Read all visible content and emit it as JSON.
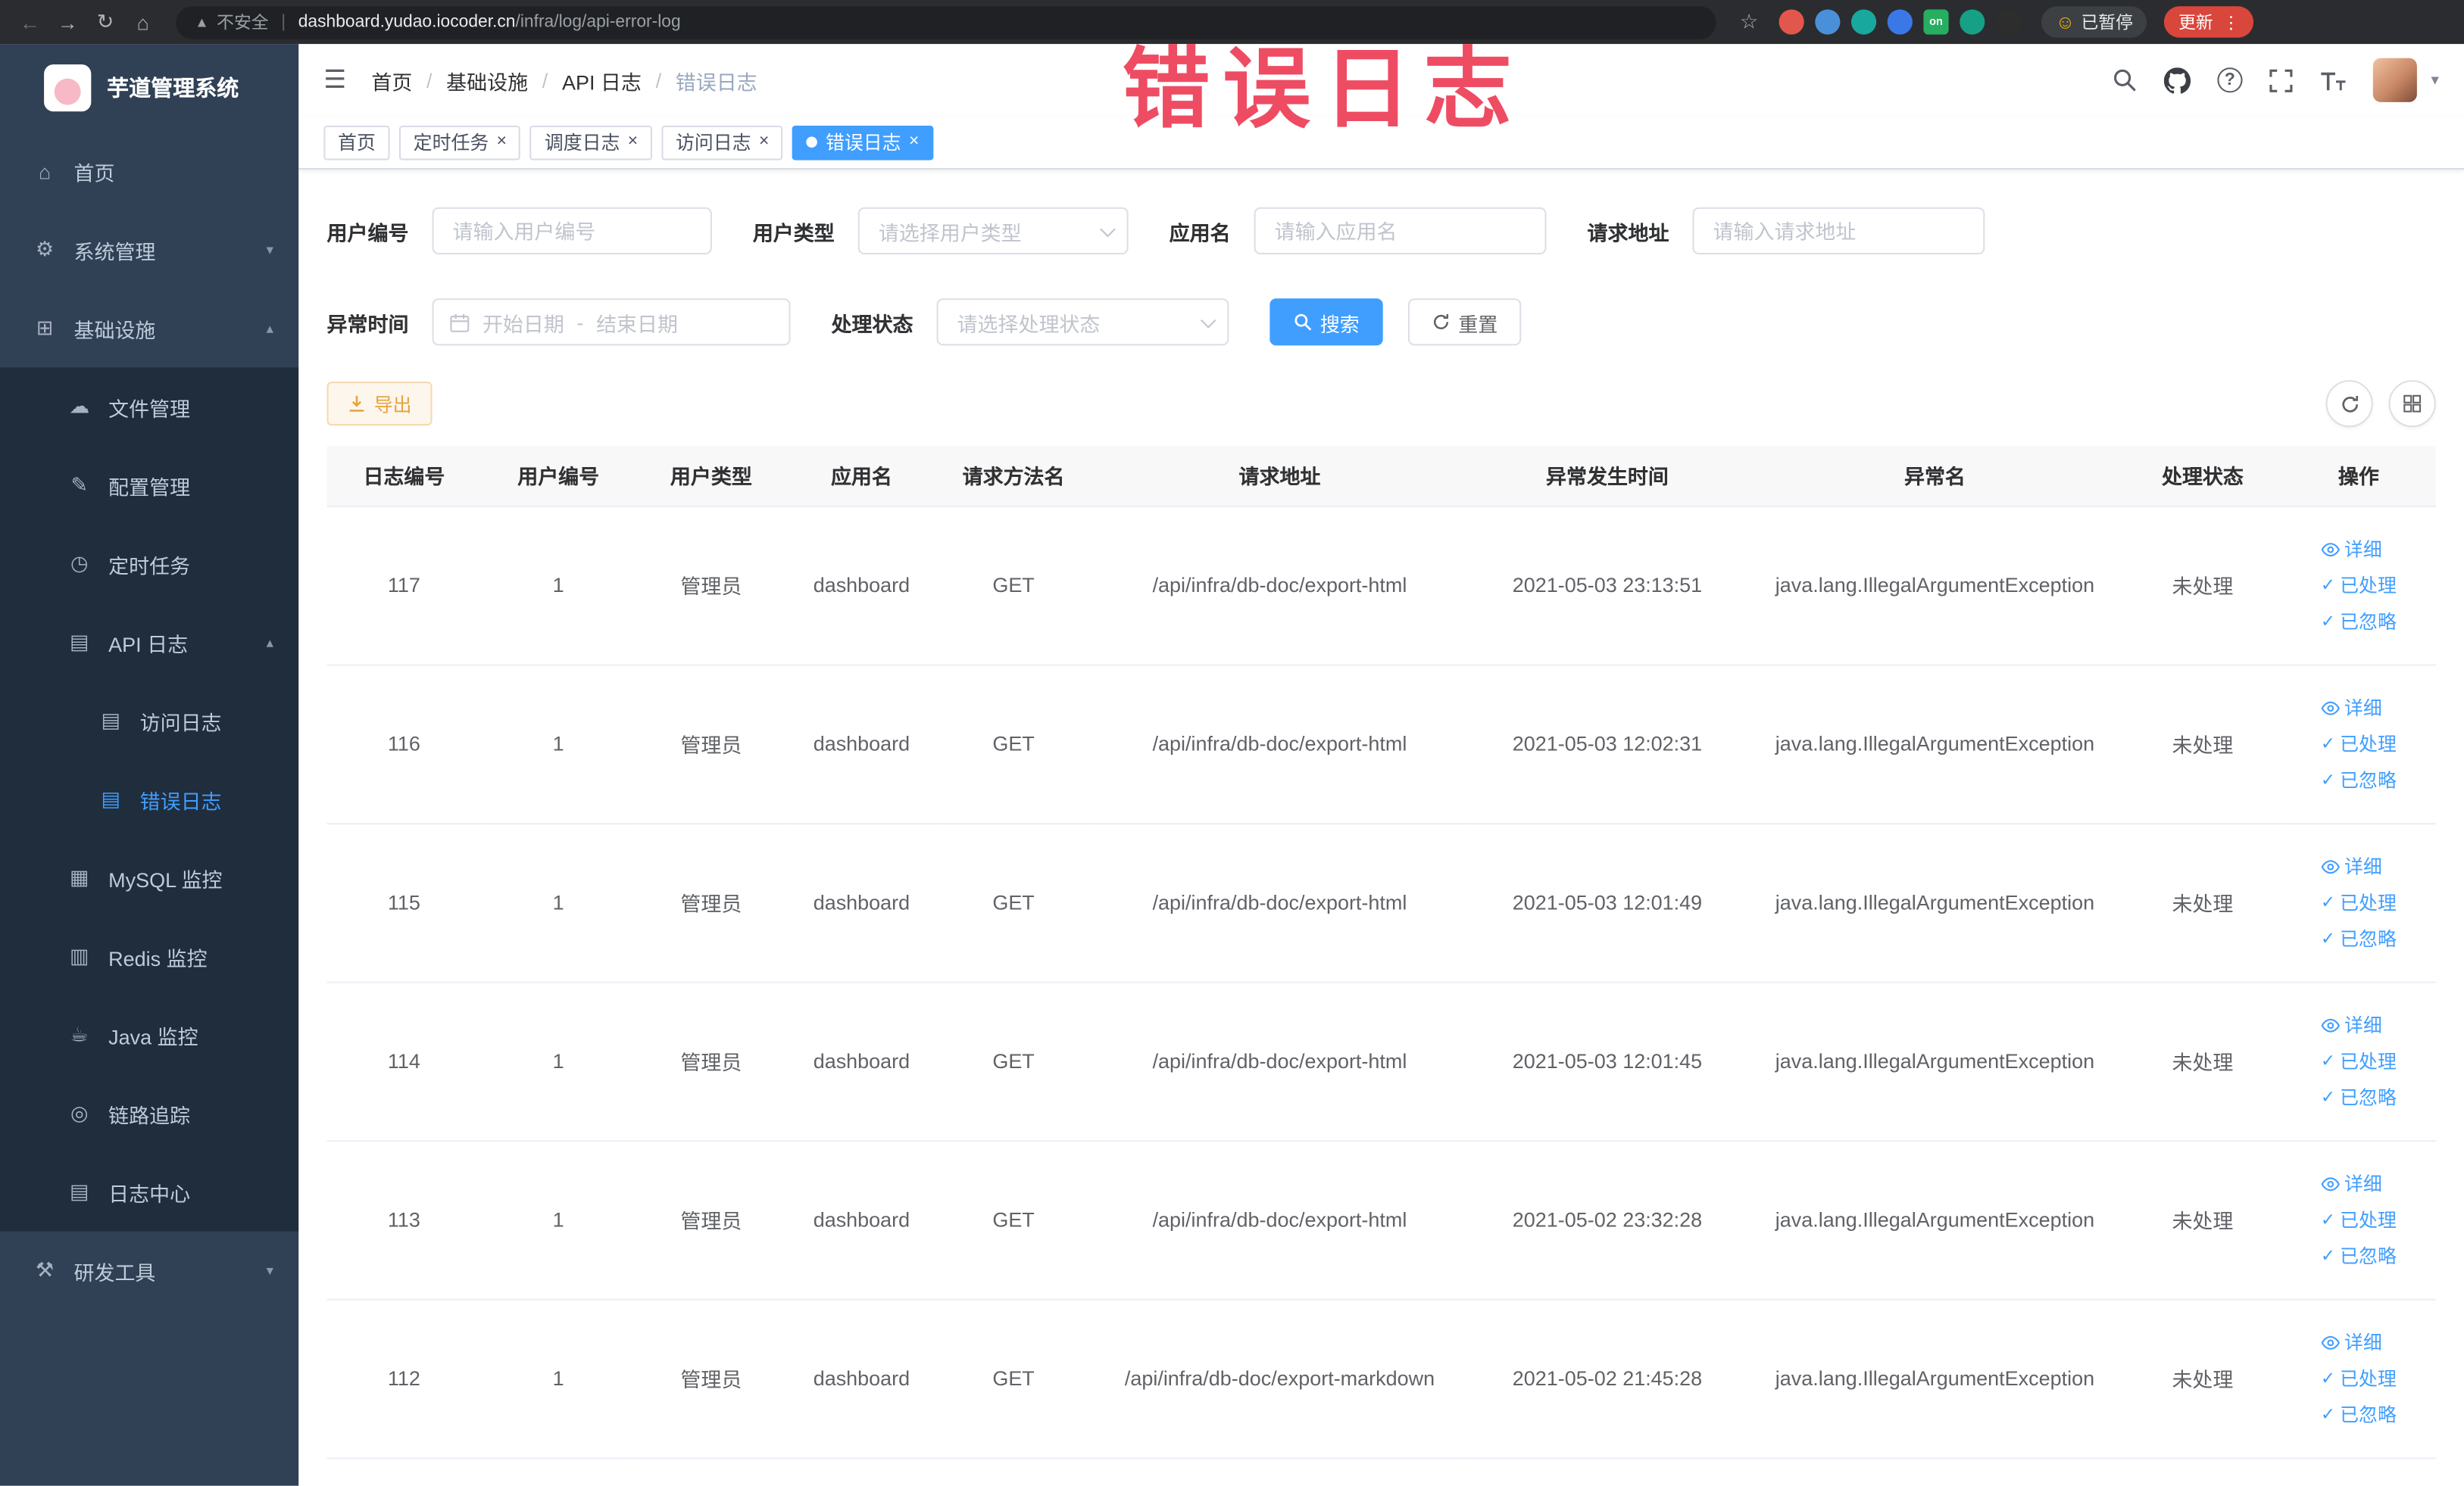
{
  "annotation": {
    "text": "错误日志"
  },
  "colors": {
    "primary": "#409eff",
    "sidebar_bg": "#304156",
    "submenu_bg": "#1f2d3d",
    "warning_text": "#e6a23c",
    "warning_bg": "#fdf6ec",
    "annotation": "#ee4c63"
  },
  "icons": {
    "back": "←",
    "forward": "→",
    "reload": "↻",
    "home": "⌂",
    "star": "☆",
    "menu": "⋮",
    "hamburger": "☰",
    "caret_down": "▾",
    "close": "×",
    "warning": "▲",
    "smiley": "☺",
    "separator": "|",
    "arrow_up": "▴",
    "arrow_down": "▾",
    "breadcrumb_separator": "/"
  },
  "browser": {
    "security_label": "不安全",
    "url_domain": "dashboard.yudao.iocoder.cn",
    "url_path": "/infra/log/api-error-log",
    "paused_label": "已暂停",
    "update_label": "更新",
    "ext_on_label": "on"
  },
  "sidebar": {
    "logo_title": "芋道管理系统",
    "items": [
      {
        "key": "home",
        "label": "首页",
        "level": 1,
        "icon": "home-icon",
        "glyph": "⌂"
      },
      {
        "key": "system-management",
        "label": "系统管理",
        "level": 1,
        "icon": "gear-icon",
        "glyph": "⚙",
        "arrow": "down"
      },
      {
        "key": "infrastructure",
        "label": "基础设施",
        "level": 1,
        "icon": "grid-icon",
        "glyph": "⊞",
        "arrow": "up"
      },
      {
        "key": "file-management",
        "label": "文件管理",
        "level": 2,
        "icon": "cloud-icon",
        "glyph": "☁"
      },
      {
        "key": "config-management",
        "label": "配置管理",
        "level": 2,
        "icon": "edit-icon",
        "glyph": "✎"
      },
      {
        "key": "scheduled-tasks",
        "label": "定时任务",
        "level": 2,
        "icon": "clock-icon",
        "glyph": "◷"
      },
      {
        "key": "api-log",
        "label": "API 日志",
        "level": 2,
        "icon": "document-icon",
        "glyph": "▤",
        "arrow": "up"
      },
      {
        "key": "access-log",
        "label": "访问日志",
        "level": 3,
        "icon": "document-icon",
        "glyph": "▤"
      },
      {
        "key": "error-log",
        "label": "错误日志",
        "level": 3,
        "icon": "document-icon",
        "glyph": "▤",
        "active": true
      },
      {
        "key": "mysql-monitor",
        "label": "MySQL 监控",
        "level": 2,
        "icon": "monitor-icon",
        "glyph": "▦"
      },
      {
        "key": "redis-monitor",
        "label": "Redis 监控",
        "level": 2,
        "icon": "database-icon",
        "glyph": "▥"
      },
      {
        "key": "java-monitor",
        "label": "Java 监控",
        "level": 2,
        "icon": "coffee-icon",
        "glyph": "☕"
      },
      {
        "key": "tracing",
        "label": "链路追踪",
        "level": 2,
        "icon": "trace-icon",
        "glyph": "◎"
      },
      {
        "key": "log-center",
        "label": "日志中心",
        "level": 2,
        "icon": "log-icon",
        "glyph": "▤"
      },
      {
        "key": "dev-tools",
        "label": "研发工具",
        "level": 1,
        "icon": "tools-icon",
        "glyph": "⚒",
        "arrow": "down"
      }
    ]
  },
  "header": {
    "breadcrumb": [
      "首页",
      "基础设施",
      "API 日志",
      "错误日志"
    ]
  },
  "tabs": [
    {
      "key": "home",
      "label": "首页",
      "closable": false,
      "active": false
    },
    {
      "key": "scheduled-tasks",
      "label": "定时任务",
      "closable": true,
      "active": false
    },
    {
      "key": "schedule-log",
      "label": "调度日志",
      "closable": true,
      "active": false
    },
    {
      "key": "access-log",
      "label": "访问日志",
      "closable": true,
      "active": false
    },
    {
      "key": "error-log",
      "label": "错误日志",
      "closable": true,
      "active": true
    }
  ],
  "filters": {
    "user_id": {
      "label": "用户编号",
      "placeholder": "请输入用户编号"
    },
    "user_type": {
      "label": "用户类型",
      "placeholder": "请选择用户类型"
    },
    "app_name": {
      "label": "应用名",
      "placeholder": "请输入应用名"
    },
    "request_url": {
      "label": "请求地址",
      "placeholder": "请输入请求地址"
    },
    "exception_time": {
      "label": "异常时间",
      "start_placeholder": "开始日期",
      "separator": "-",
      "end_placeholder": "结束日期"
    },
    "process_status": {
      "label": "处理状态",
      "placeholder": "请选择处理状态"
    },
    "search_label": "搜索",
    "reset_label": "重置"
  },
  "toolbar": {
    "export_label": "导出"
  },
  "table": {
    "columns": [
      "日志编号",
      "用户编号",
      "用户类型",
      "应用名",
      "请求方法名",
      "请求地址",
      "异常发生时间",
      "异常名",
      "处理状态",
      "操作"
    ],
    "actions": {
      "detail": "详细",
      "processed": "已处理",
      "ignored": "已忽略"
    },
    "rows": [
      {
        "id": "117",
        "user_id": "1",
        "user_type": "管理员",
        "app": "dashboard",
        "method": "GET",
        "url": "/api/infra/db-doc/export-html",
        "time": "2021-05-03 23:13:51",
        "exception": "java.lang.IllegalArgumentException",
        "status": "未处理"
      },
      {
        "id": "116",
        "user_id": "1",
        "user_type": "管理员",
        "app": "dashboard",
        "method": "GET",
        "url": "/api/infra/db-doc/export-html",
        "time": "2021-05-03 12:02:31",
        "exception": "java.lang.IllegalArgumentException",
        "status": "未处理"
      },
      {
        "id": "115",
        "user_id": "1",
        "user_type": "管理员",
        "app": "dashboard",
        "method": "GET",
        "url": "/api/infra/db-doc/export-html",
        "time": "2021-05-03 12:01:49",
        "exception": "java.lang.IllegalArgumentException",
        "status": "未处理"
      },
      {
        "id": "114",
        "user_id": "1",
        "user_type": "管理员",
        "app": "dashboard",
        "method": "GET",
        "url": "/api/infra/db-doc/export-html",
        "time": "2021-05-03 12:01:45",
        "exception": "java.lang.IllegalArgumentException",
        "status": "未处理"
      },
      {
        "id": "113",
        "user_id": "1",
        "user_type": "管理员",
        "app": "dashboard",
        "method": "GET",
        "url": "/api/infra/db-doc/export-html",
        "time": "2021-05-02 23:32:28",
        "exception": "java.lang.IllegalArgumentException",
        "status": "未处理"
      },
      {
        "id": "112",
        "user_id": "1",
        "user_type": "管理员",
        "app": "dashboard",
        "method": "GET",
        "url": "/api/infra/db-doc/export-markdown",
        "time": "2021-05-02 21:45:28",
        "exception": "java.lang.IllegalArgumentException",
        "status": "未处理"
      }
    ]
  }
}
